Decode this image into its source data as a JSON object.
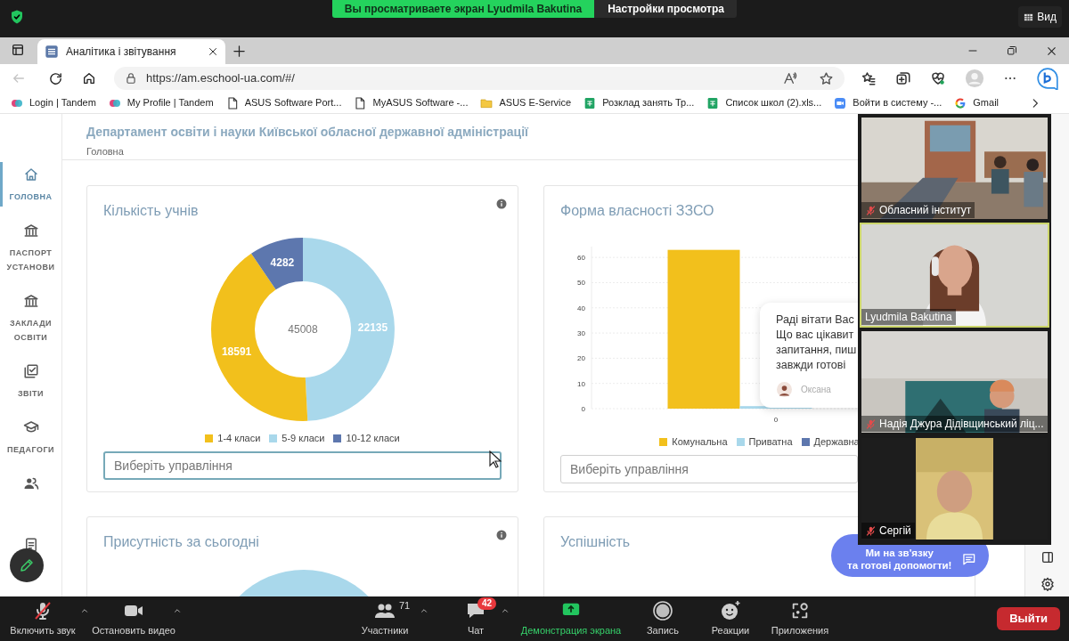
{
  "zoom_top_bar": {
    "banner": "Вы просматриваете экран Lyudmila Bakutina",
    "view_options": "Настройки просмотра",
    "view_button": "Вид"
  },
  "browser": {
    "tabs": [
      {
        "title": "Аналітика і звітування",
        "selected": true
      }
    ],
    "url": "https://am.eschool-ua.com/#/",
    "back_disabled": true,
    "bookmarks": [
      {
        "kind": "tandem",
        "label": "Login | Tandem"
      },
      {
        "kind": "tandem",
        "label": "My Profile | Tandem"
      },
      {
        "kind": "page",
        "label": "ASUS Software Port..."
      },
      {
        "kind": "page",
        "label": "MyASUS Software -..."
      },
      {
        "kind": "folder",
        "label": "ASUS E-Service"
      },
      {
        "kind": "sheet",
        "label": "Розклад занять Тр..."
      },
      {
        "kind": "sheet",
        "label": "Список школ (2).xls..."
      },
      {
        "kind": "zoom",
        "label": "Войти в систему -..."
      },
      {
        "kind": "google",
        "label": "Gmail"
      }
    ]
  },
  "page": {
    "title": "Департамент освіти і науки Київської обласної державної адміністрації",
    "breadcrumb": "Головна",
    "sidebar": {
      "items": [
        {
          "kind": "home",
          "label": "ГОЛОВНА",
          "selected": true
        },
        {
          "kind": "bank",
          "label": "ПАСПОРТ УСТАНОВИ",
          "selected": false
        },
        {
          "kind": "bank",
          "label": "ЗАКЛАДИ ОСВІТИ",
          "selected": false
        },
        {
          "kind": "report",
          "label": "ЗВІТИ",
          "selected": false
        },
        {
          "kind": "cap",
          "label": "ПЕДАГОГИ",
          "selected": false
        },
        {
          "kind": "people",
          "selected": false
        },
        {
          "kind": "doc",
          "selected": false
        }
      ]
    },
    "cards": [
      {
        "title": "Кількість учнів",
        "info": true,
        "total": "45008",
        "select_placeholder": "Виберіть управління",
        "focused": true,
        "chart_data": {
          "type": "donut",
          "categories": [
            "1-4 класи",
            "5-9 класи",
            "10-12 класи"
          ],
          "values": [
            18591,
            22135,
            4282
          ],
          "colors": [
            "#f2c01c",
            "#a9d8eb",
            "#5d77ae"
          ],
          "data_labels": true
        }
      },
      {
        "title": "Форма власності ЗЗСО",
        "select_placeholder": "Виберіть управління",
        "focused": false,
        "chart_data": {
          "type": "bar",
          "categories": [
            "0"
          ],
          "series": [
            {
              "name": "Комунальна",
              "color": "#f2c01c",
              "values": [
                63
              ]
            },
            {
              "name": "Приватна",
              "color": "#a9d8eb",
              "values": [
                1
              ]
            },
            {
              "name": "Державна",
              "color": "#5d77ae",
              "values": [
                0
              ]
            }
          ],
          "ylim": [
            0,
            65
          ],
          "yticks": [
            0,
            10,
            20,
            30,
            40,
            50,
            60
          ],
          "grid": true
        }
      },
      {
        "kind": "partial",
        "title": "Присутність за сьогодні",
        "info": true
      },
      {
        "kind": "empty",
        "title": "Успішність"
      }
    ],
    "chat_popup": {
      "lines": [
        "Раді вітати Вас",
        "Що вас цікавит",
        "запитання, пиш",
        "завжди готові"
      ],
      "author": "Оксана"
    },
    "support_widget": {
      "lines": [
        "Ми на зв'язку",
        "та готові допомогти!"
      ]
    }
  },
  "video_panel": {
    "tiles": [
      {
        "kind": "room",
        "name": "Обласний інститут",
        "muted": true,
        "speaking": false
      },
      {
        "kind": "woman",
        "name": "Lyudmila Bakutina",
        "muted": false,
        "speaking": true
      },
      {
        "kind": "hall",
        "name": "Надія Джура Дідівщинський ліц...",
        "muted": true,
        "speaking": false
      },
      {
        "kind": "man",
        "name": "Сергій",
        "muted": true,
        "speaking": false
      }
    ]
  },
  "toolbar": {
    "items": [
      {
        "kind": "mic",
        "label": "Включить звук",
        "muted": true,
        "caret": true
      },
      {
        "kind": "video",
        "label": "Остановить видео",
        "caret": true
      },
      {
        "kind": "participants",
        "label": "Участники",
        "count": "71",
        "caret": true
      },
      {
        "kind": "chat",
        "label": "Чат",
        "badge": "42",
        "caret": true
      },
      {
        "kind": "share",
        "label": "Демонстрация экрана"
      },
      {
        "kind": "record",
        "label": "Запись"
      },
      {
        "kind": "reactions",
        "label": "Реакции"
      },
      {
        "kind": "apps",
        "label": "Приложения"
      }
    ],
    "leave": "Выйти"
  }
}
